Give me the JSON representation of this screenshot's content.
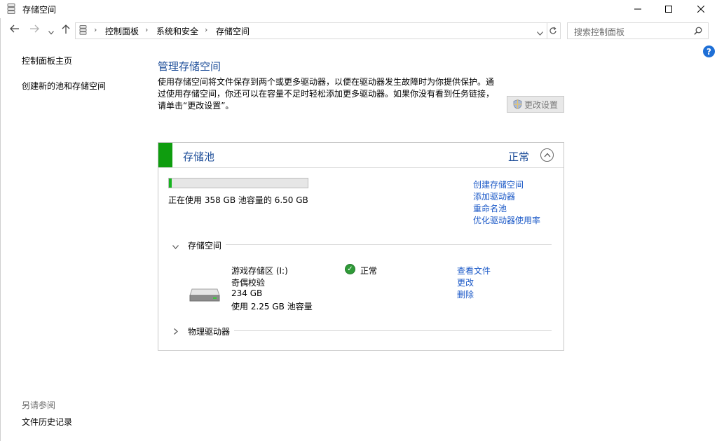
{
  "window": {
    "title": "存储空间",
    "minimize_icon": "minimize-icon",
    "maximize_icon": "maximize-icon",
    "close_icon": "close-icon"
  },
  "address_bar": {
    "breadcrumbs": [
      "控制面板",
      "系统和安全",
      "存储空间"
    ],
    "search_placeholder": "搜索控制面板"
  },
  "sidebar": {
    "items": [
      {
        "label": "控制面板主页"
      },
      {
        "label": "创建新的池和存储空间"
      }
    ],
    "see_also_heading": "另请参阅",
    "see_also_items": [
      {
        "label": "文件历史记录"
      }
    ]
  },
  "main": {
    "heading": "管理存储空间",
    "description": "使用存储空间将文件保存到两个或更多驱动器，以便在驱动器发生故障时为你提供保护。通过使用存储空间，你还可以在容量不足时轻松添加更多驱动器。如果你没有看到任务链接，请单击“更改设置”。",
    "change_settings_label": "更改设置"
  },
  "pool": {
    "title": "存储池",
    "status": "正常",
    "usage_text": "正在使用 358 GB 池容量的 6.50 GB",
    "usage_fraction": 0.0181,
    "accent_color": "#0f9d0f",
    "links": [
      "创建存储空间",
      "添加驱动器",
      "重命名池",
      "优化驱动器使用率"
    ],
    "spaces_section_label": "存储空间",
    "physical_section_label": "物理驱动器"
  },
  "space": {
    "name": "游戏存储区 (I:)",
    "resiliency": "奇偶校验",
    "size": "234 GB",
    "usage": "使用 2.25 GB 池容量",
    "status": "正常",
    "links": [
      "查看文件",
      "更改",
      "删除"
    ]
  }
}
